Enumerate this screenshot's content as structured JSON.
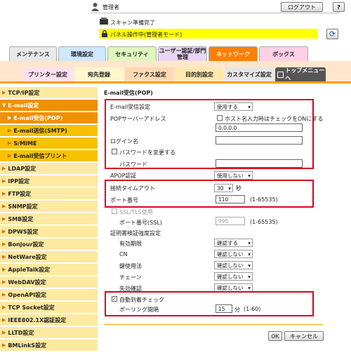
{
  "header": {
    "user": "管理者",
    "logout": "ログアウト",
    "status_scan": "スキャン準備完了",
    "status_panel": "パネル操作中(管理者モード)"
  },
  "tabs": {
    "maintenance": "メンテナンス",
    "env": "環境設定",
    "security": "セキュリティ",
    "auth": "ユーザー認証/部門管理",
    "network": "ネットワーク",
    "box": "ボックス"
  },
  "subtabs": {
    "printer": "プリンター設定",
    "dest": "宛先登録",
    "fax": "ファクス設定",
    "purpose": "目的別設定",
    "customize": "カスタマイズ設定",
    "topmenu": "トップメニューへ"
  },
  "sidebar": [
    {
      "label": "TCP/IP設定"
    },
    {
      "label": "E-mail設定"
    },
    {
      "label": "E-mail受信(POP)"
    },
    {
      "label": "E-mail送信(SMTP)"
    },
    {
      "label": "S/MIME"
    },
    {
      "label": "E-mail受信プリント"
    },
    {
      "label": "LDAP設定"
    },
    {
      "label": "IPP設定"
    },
    {
      "label": "FTP設定"
    },
    {
      "label": "SNMP設定"
    },
    {
      "label": "SMB設定"
    },
    {
      "label": "DPWS設定"
    },
    {
      "label": "Bonjour設定"
    },
    {
      "label": "NetWare設定"
    },
    {
      "label": "AppleTalk設定"
    },
    {
      "label": "WebDAV設定"
    },
    {
      "label": "OpenAPI設定"
    },
    {
      "label": "TCP Socket設定"
    },
    {
      "label": "IEEE802.1X認証設定"
    },
    {
      "label": "LLTD設定"
    },
    {
      "label": "BMLinkS設定"
    }
  ],
  "form": {
    "title": "E-mail受信(POP)",
    "email_recv_label": "E-mail受信設定",
    "email_recv_value": "使用する",
    "pop_server_label": "POPサーバーアドレス",
    "host_check_label": "ホスト名入力時はチェックをONにする",
    "pop_server_value": "0.0.0.0",
    "login_label": "ログイン名",
    "login_value": "",
    "pwd_change_label": "パスワードを変更する",
    "pwd_label": "パスワード",
    "pwd_value": "",
    "apop_label": "APOP認証",
    "apop_value": "使用しない",
    "timeout_label": "接続タイムアウト",
    "timeout_value": "30",
    "timeout_unit": "秒",
    "port_label": "ポート番号",
    "port_value": "110",
    "port_range": "(1-65535)",
    "ssl_label": "SSL/TLS使用",
    "ssl_port_label": "ポート番号(SSL)",
    "ssl_port_value": "995",
    "ssl_port_range": "(1-65535)",
    "cert_label": "証明書検証強度設定",
    "valid_label": "有効期限",
    "valid_value": "確認する",
    "cn_label": "CN",
    "cn_value": "確認しない",
    "keyuse_label": "鍵使用法",
    "keyuse_value": "確認しない",
    "chain_label": "チェーン",
    "chain_value": "確認しない",
    "revoke_label": "失効確認",
    "revoke_value": "確認しない",
    "auto_check_label": "自動到着チェック",
    "polling_label": "ポーリング間隔",
    "polling_value": "15",
    "polling_unit": "分",
    "polling_range": "(1-60)",
    "ok": "OK",
    "cancel": "キャンセル"
  }
}
